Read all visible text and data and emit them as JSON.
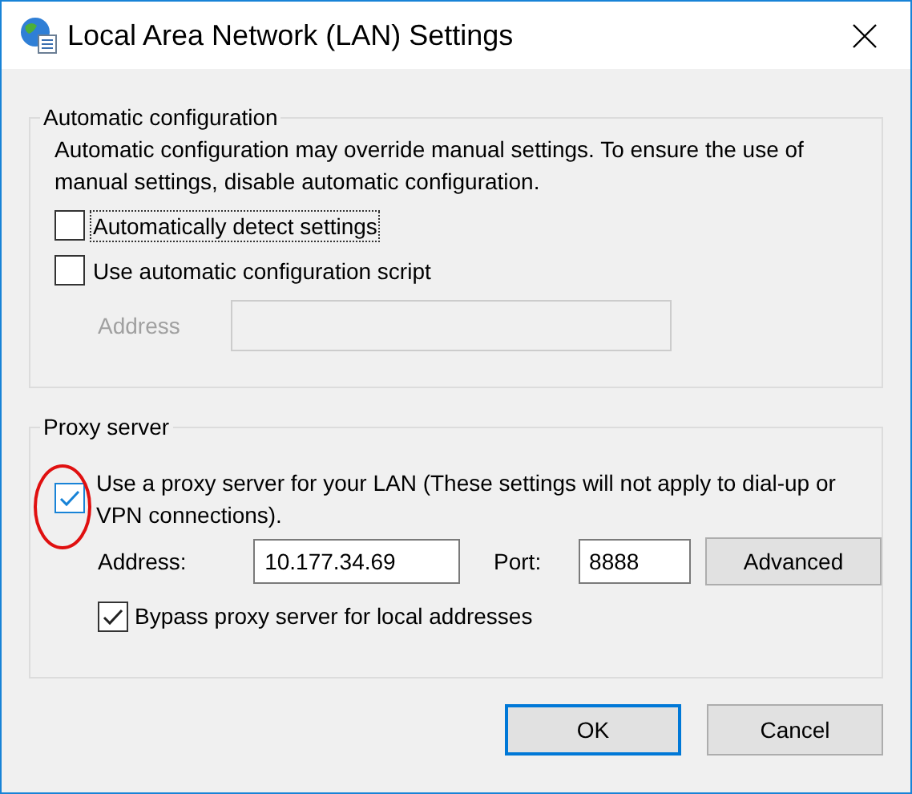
{
  "window": {
    "title": "Local Area Network (LAN) Settings"
  },
  "automatic_configuration": {
    "title": "Automatic configuration",
    "description": "Automatic configuration may override manual settings.  To ensure the use of manual settings, disable automatic configuration.",
    "options": [
      {
        "label": "Automatically detect settings",
        "checked": false,
        "focused": true
      },
      {
        "label": "Use automatic configuration script",
        "checked": false,
        "focused": false
      }
    ],
    "address": {
      "label": "Address",
      "disabled": true
    }
  },
  "proxy_server": {
    "title": "Proxy server",
    "use_proxy": {
      "label": "Use a proxy server for your LAN (These settings will not apply to dial-up or VPN connections).",
      "checked": true
    },
    "address": {
      "label": "Address:",
      "value": "10.177.34.69"
    },
    "port": {
      "label": "Port:",
      "value": "8888"
    },
    "advanced_button": "Advanced",
    "bypass": {
      "label": "Bypass proxy server for local addresses",
      "checked": true
    }
  },
  "buttons": [
    {
      "label": "OK",
      "default": true
    },
    {
      "label": "Cancel",
      "default": false
    }
  ]
}
